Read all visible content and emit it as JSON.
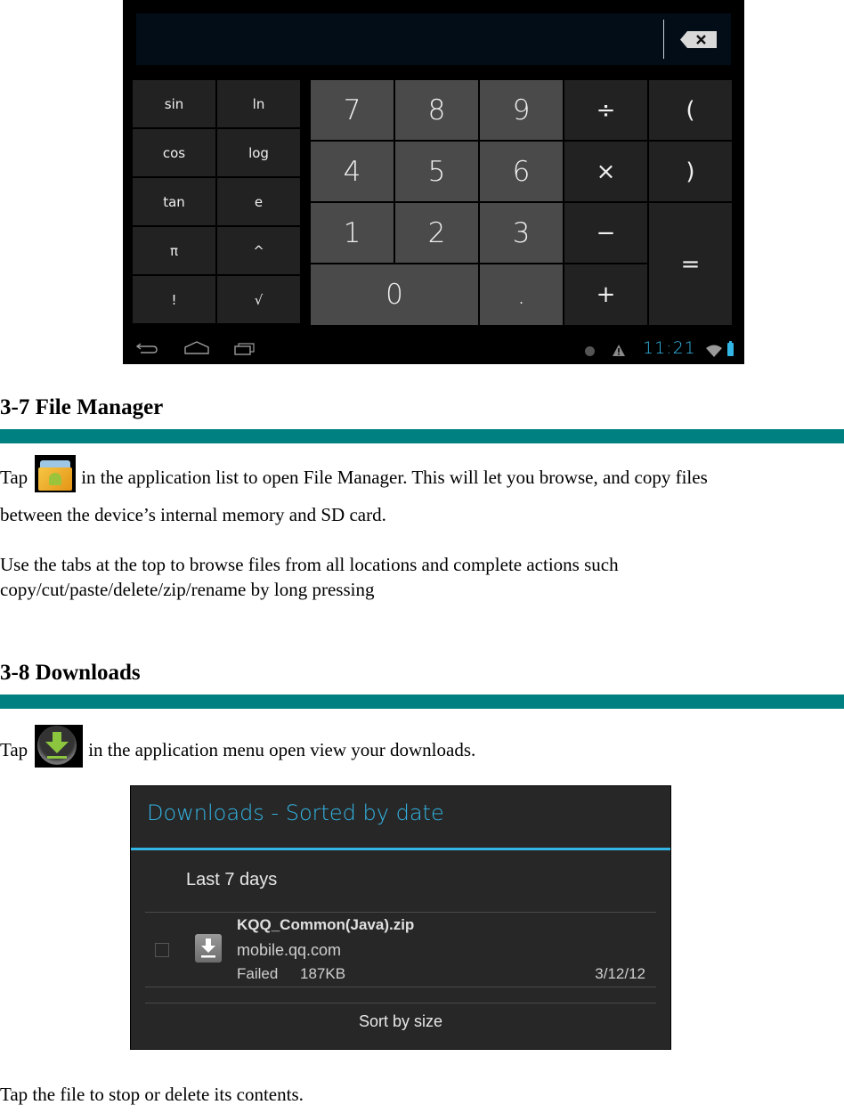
{
  "calculator": {
    "display_value": "",
    "backspace_icon": "backspace-icon",
    "advanced_keys": [
      "sin",
      "ln",
      "cos",
      "log",
      "tan",
      "e",
      "π",
      "^",
      "!",
      "√"
    ],
    "pad_keys": {
      "row1": [
        "7",
        "8",
        "9",
        "÷",
        "("
      ],
      "row2": [
        "4",
        "5",
        "6",
        "×",
        ")"
      ],
      "row3": [
        "1",
        "2",
        "3",
        "−"
      ],
      "row4": [
        "0",
        ".",
        "+"
      ],
      "equals": "="
    },
    "navbar": {
      "back_icon": "back-icon",
      "home_icon": "home-icon",
      "recents_icon": "recent-apps-icon"
    },
    "status_bar": {
      "time": "11:21",
      "icons": [
        "notification-dot-icon",
        "warning-icon",
        "wifi-icon",
        "battery-charging-icon"
      ]
    }
  },
  "section_file_manager": {
    "heading": "3-7 File Manager",
    "para1_pre": "Tap",
    "para1_post": "in the application list to open File Manager. This will let you browse, and copy files",
    "para1_line2": "between the device’s internal memory and SD card.",
    "para2": "Use the tabs at the top to browse files from all locations and complete actions such copy/cut/paste/delete/zip/rename by long pressing",
    "icon": "file-manager-app-icon"
  },
  "section_downloads": {
    "heading": "3-8 Downloads",
    "para1_pre": "Tap",
    "para1_post": "in the application menu open view your downloads.",
    "icon": "downloads-app-icon",
    "footer_text": "Tap the file to stop or delete its contents."
  },
  "downloads_screen": {
    "title": "Downloads - Sorted by date",
    "section_label": "Last 7 days",
    "items": [
      {
        "name": "KQQ_Common(Java).zip",
        "host": "mobile.qq.com",
        "status": "Failed",
        "size": "187KB",
        "date": "3/12/12",
        "checked": false
      }
    ],
    "sort_button": "Sort by size",
    "accent_color": "#33b5e5"
  },
  "colors": {
    "heading_rule": "#008080",
    "android_holo_blue": "#33b5e5"
  }
}
